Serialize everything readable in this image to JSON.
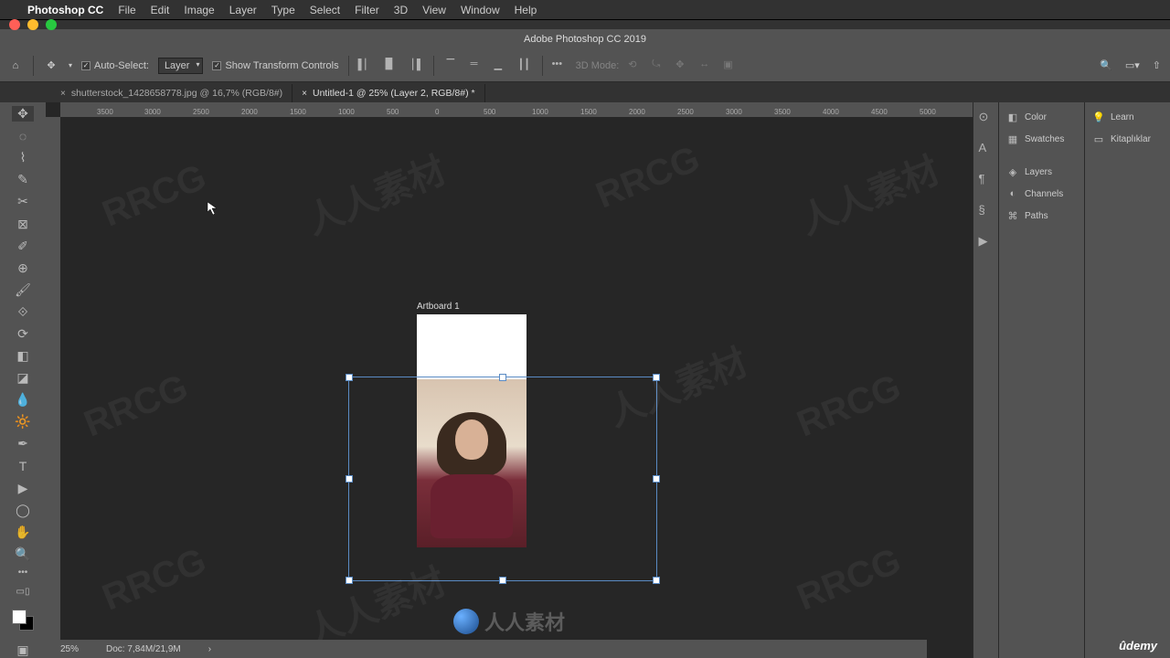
{
  "menubar": {
    "app": "Photoshop CC",
    "items": [
      "File",
      "Edit",
      "Image",
      "Layer",
      "Type",
      "Select",
      "Filter",
      "3D",
      "View",
      "Window",
      "Help"
    ]
  },
  "titlebar": "Adobe Photoshop CC 2019",
  "options": {
    "auto_select": "Auto-Select:",
    "auto_select_mode": "Layer",
    "show_transform": "Show Transform Controls",
    "mode3d": "3D Mode:"
  },
  "tabs": {
    "t1": "shutterstock_1428658778.jpg @ 16,7% (RGB/8#)",
    "t2": "Untitled-1 @ 25% (Layer 2, RGB/8#) *"
  },
  "ruler": [
    "3500",
    "3000",
    "2500",
    "2000",
    "1500",
    "1000",
    "500",
    "0",
    "500",
    "1000",
    "1500",
    "2000",
    "2500",
    "3000",
    "3500",
    "4000",
    "4500",
    "5000"
  ],
  "artboard_label": "Artboard 1",
  "panels_left": {
    "color": "Color",
    "swatches": "Swatches",
    "layers": "Layers",
    "channels": "Channels",
    "paths": "Paths"
  },
  "panels_right": {
    "learn": "Learn",
    "libraries": "Kitaplıklar"
  },
  "status": {
    "zoom": "25%",
    "doc": "Doc: 7,84M/21,9M"
  },
  "watermark": "RRCG",
  "watermark_cn": "人人素材",
  "udemy": "ûdemy"
}
